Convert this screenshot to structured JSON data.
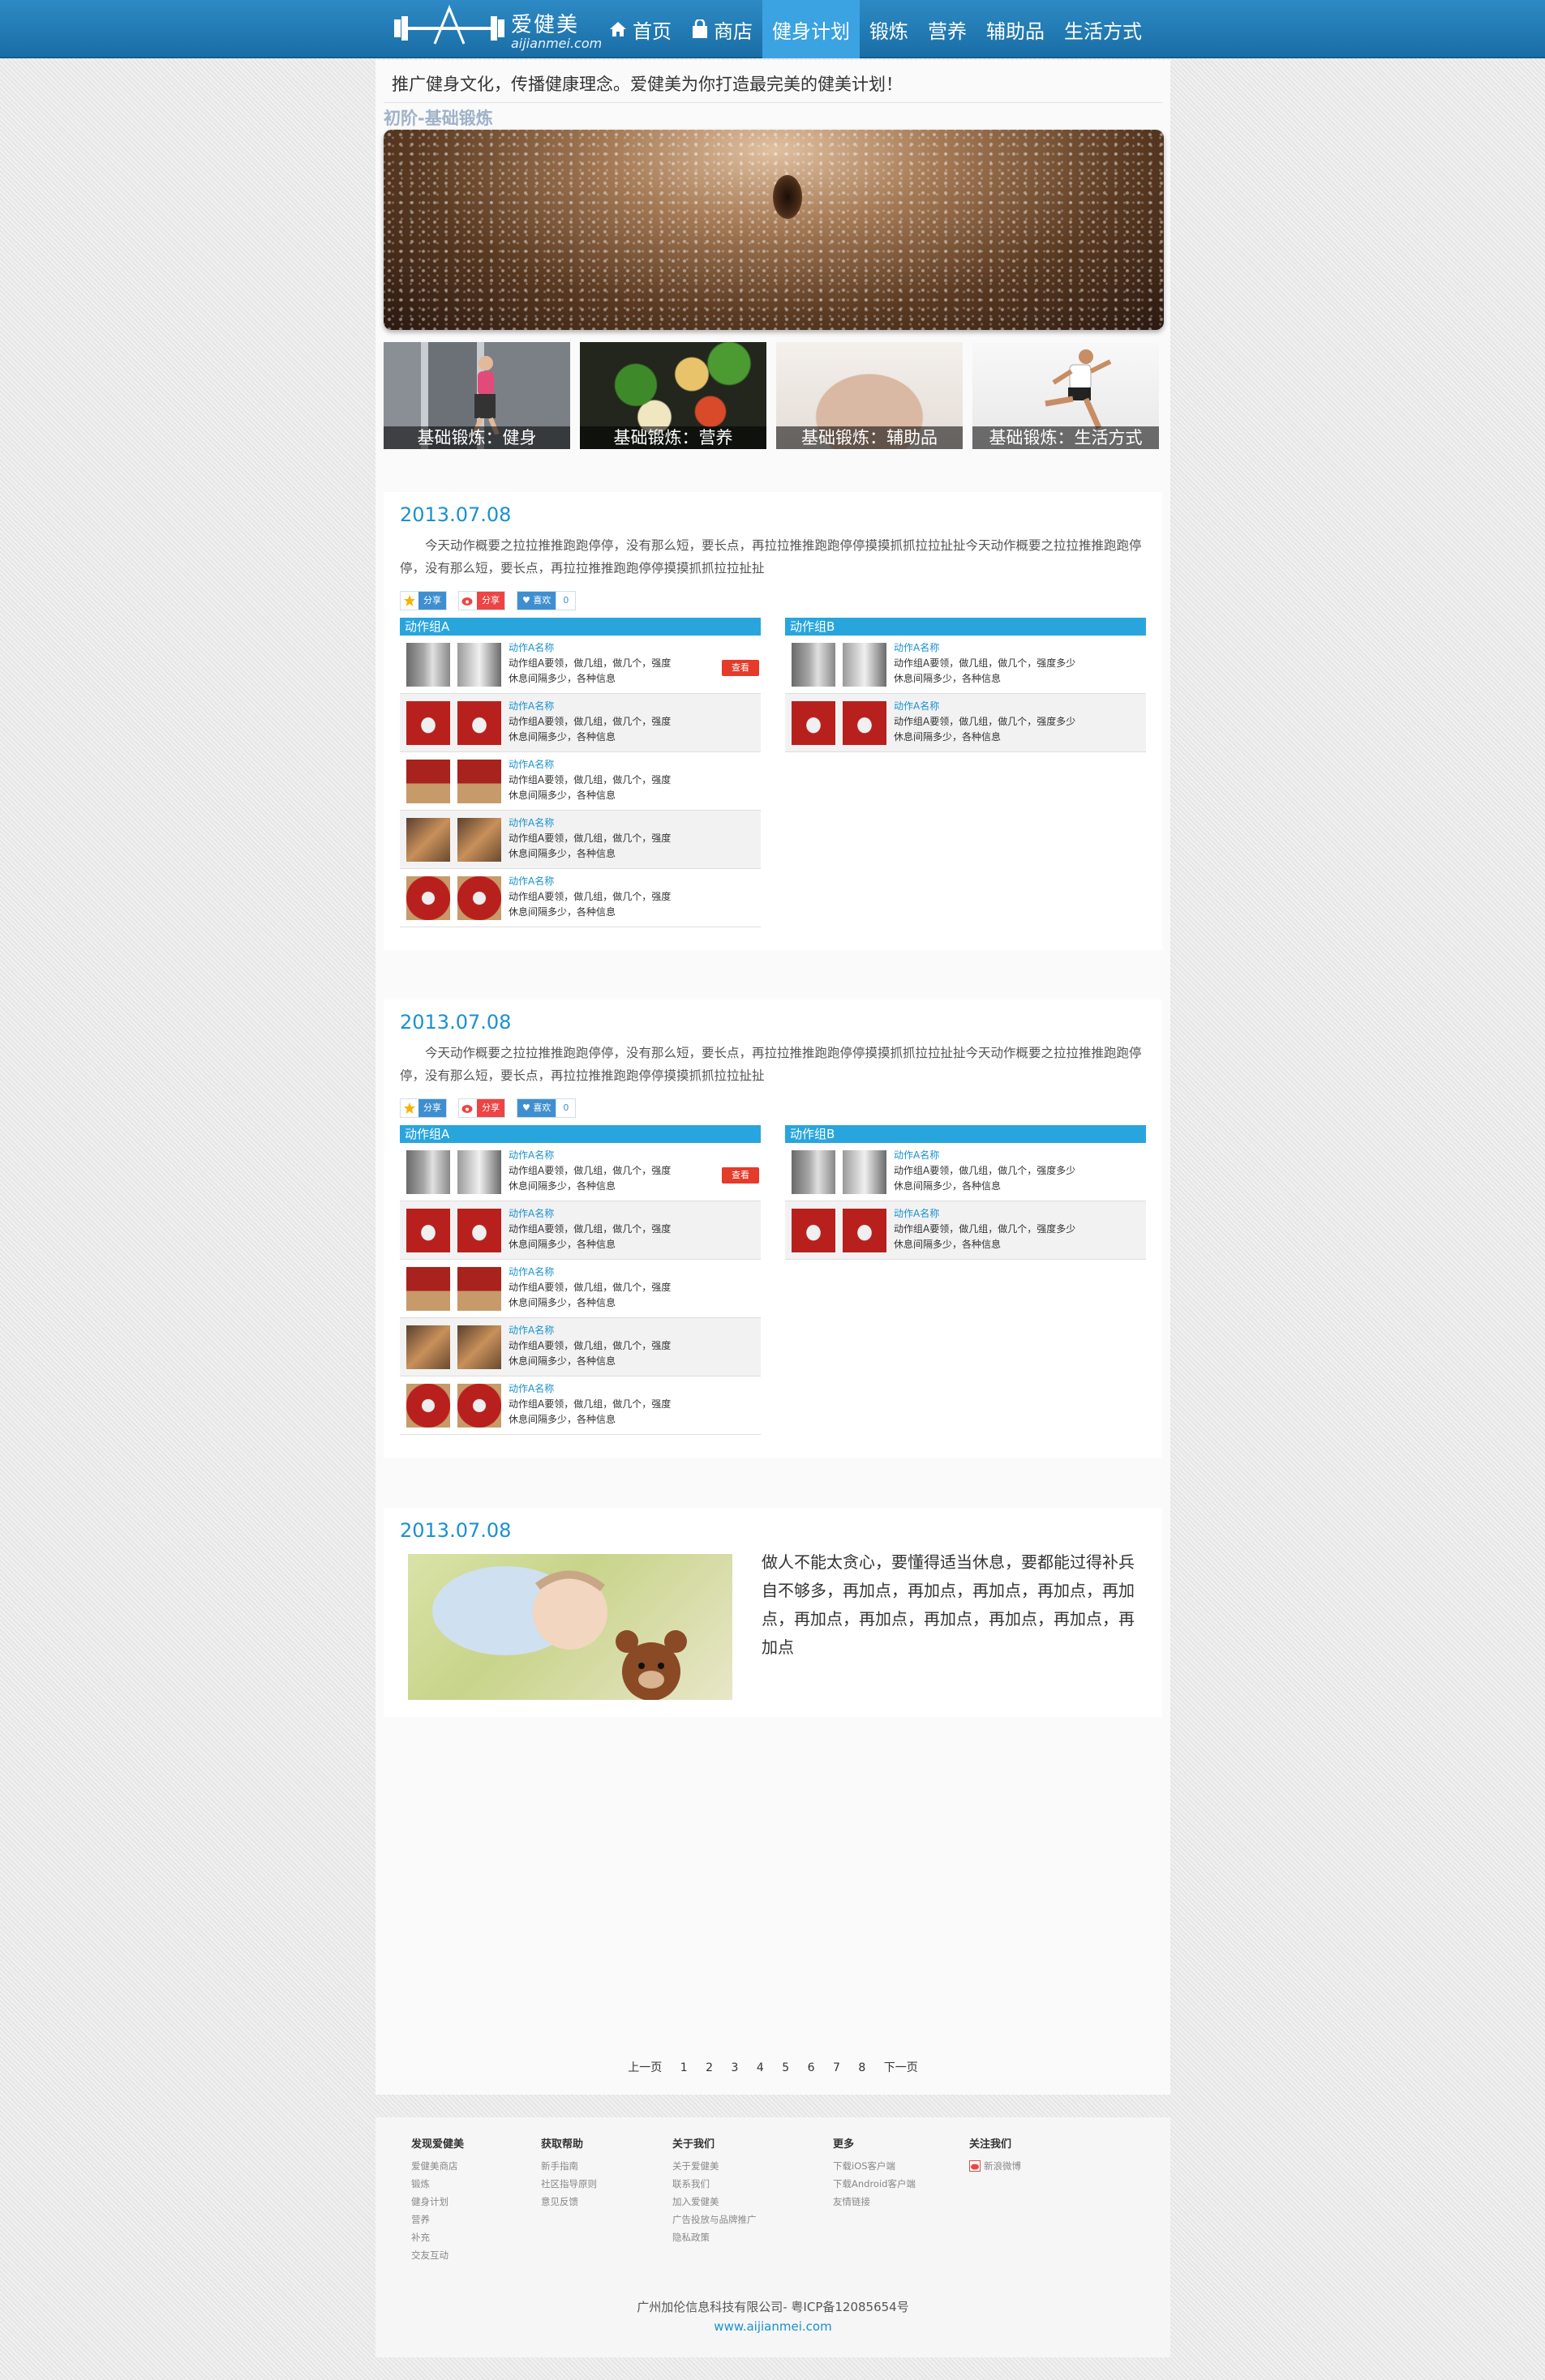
{
  "header": {
    "logo_cn": "爱健美",
    "logo_url": "aijianmei.com",
    "nav": [
      {
        "label": "首页"
      },
      {
        "label": "商店"
      },
      {
        "label": "健身计划"
      },
      {
        "label": "锻炼"
      },
      {
        "label": "营养"
      },
      {
        "label": "辅助品"
      },
      {
        "label": "生活方式"
      }
    ],
    "active_index": 2
  },
  "slogan": "推广健身文化，传播健康理念。爱健美为你打造最完美的健美计划！",
  "breadcrumb": "初阶-基础锻炼",
  "thumbs": [
    {
      "label": "基础锻炼：健身"
    },
    {
      "label": "基础锻炼：营养"
    },
    {
      "label": "基础锻炼：辅助品"
    },
    {
      "label": "基础锻炼：生活方式"
    }
  ],
  "articles": [
    {
      "date": "2013.07.08",
      "text": "今天动作概要之拉拉推推跑跑停停，没有那么短，要长点，再拉拉推推跑跑停停摸摸抓抓拉拉扯扯今天动作概要之拉拉推推跑跑停停，没有那么短，要长点，再拉拉推推跑跑停停摸摸抓抓拉拉扯扯",
      "share": "分享",
      "weibo_share": "分享",
      "like": "喜欢",
      "like_count": "0",
      "group_a": {
        "title": "动作组A",
        "view": "查看",
        "items": [
          {
            "name": "动作A名称",
            "line1": "动作组A要领，做几组，做几个，强度",
            "line2": "休息间隔多少，各种信息"
          },
          {
            "name": "动作A名称",
            "line1": "动作组A要领，做几组，做几个，强度",
            "line2": "休息间隔多少，各种信息"
          },
          {
            "name": "动作A名称",
            "line1": "动作组A要领，做几组，做几个，强度",
            "line2": "休息间隔多少，各种信息"
          },
          {
            "name": "动作A名称",
            "line1": "动作组A要领，做几组，做几个，强度",
            "line2": "休息间隔多少，各种信息"
          },
          {
            "name": "动作A名称",
            "line1": "动作组A要领，做几组，做几个，强度",
            "line2": "休息间隔多少，各种信息"
          }
        ]
      },
      "group_b": {
        "title": "动作组B",
        "items": [
          {
            "name": "动作A名称",
            "line1": "动作组A要领，做几组，做几个，强度多少",
            "line2": "休息间隔多少，各种信息"
          },
          {
            "name": "动作A名称",
            "line1": "动作组A要领，做几组，做几个，强度多少",
            "line2": "休息间隔多少，各种信息"
          }
        ]
      }
    },
    {
      "date": "2013.07.08",
      "text": "今天动作概要之拉拉推推跑跑停停，没有那么短，要长点，再拉拉推推跑跑停停摸摸抓抓拉拉扯扯今天动作概要之拉拉推推跑跑停停，没有那么短，要长点，再拉拉推推跑跑停停摸摸抓抓拉拉扯扯",
      "share": "分享",
      "weibo_share": "分享",
      "like": "喜欢",
      "like_count": "0",
      "group_a": {
        "title": "动作组A",
        "view": "查看",
        "items": [
          {
            "name": "动作A名称",
            "line1": "动作组A要领，做几组，做几个，强度",
            "line2": "休息间隔多少，各种信息"
          },
          {
            "name": "动作A名称",
            "line1": "动作组A要领，做几组，做几个，强度",
            "line2": "休息间隔多少，各种信息"
          },
          {
            "name": "动作A名称",
            "line1": "动作组A要领，做几组，做几个，强度",
            "line2": "休息间隔多少，各种信息"
          },
          {
            "name": "动作A名称",
            "line1": "动作组A要领，做几组，做几个，强度",
            "line2": "休息间隔多少，各种信息"
          },
          {
            "name": "动作A名称",
            "line1": "动作组A要领，做几组，做几个，强度",
            "line2": "休息间隔多少，各种信息"
          }
        ]
      },
      "group_b": {
        "title": "动作组B",
        "items": [
          {
            "name": "动作A名称",
            "line1": "动作组A要领，做几组，做几个，强度多少",
            "line2": "休息间隔多少，各种信息"
          },
          {
            "name": "动作A名称",
            "line1": "动作组A要领，做几组，做几个，强度多少",
            "line2": "休息间隔多少，各种信息"
          }
        ]
      }
    }
  ],
  "story": {
    "date": "2013.07.08",
    "text": "做人不能太贪心，要懂得适当休息，要都能过得补兵自不够多，再加点，再加点，再加点，再加点，再加点，再加点，再加点，再加点，再加点，再加点，再加点"
  },
  "pager": {
    "prev": "上一页",
    "pages": [
      "1",
      "2",
      "3",
      "4",
      "5",
      "6",
      "7",
      "8"
    ],
    "next": "下一页"
  },
  "footer": {
    "cols": [
      {
        "title": "发现爱健美",
        "links": [
          "爱健美商店",
          "锻炼",
          "健身计划",
          "营养",
          "补充",
          "交友互动"
        ]
      },
      {
        "title": "获取帮助",
        "links": [
          "新手指南",
          "社区指导原则",
          "意见反馈"
        ]
      },
      {
        "title": "关于我们",
        "links": [
          "关于爱健美",
          "联系我们",
          "加入爱健美",
          "广告投放与品牌推广",
          "隐私政策"
        ]
      },
      {
        "title": "更多",
        "links": [
          "下载iOS客户端",
          "下载Android客户端",
          "友情链接"
        ]
      },
      {
        "title": "关注我们",
        "links": [
          "新浪微博"
        ]
      }
    ],
    "company": "广州加伦信息科技有限公司- 粤ICP备12085654号",
    "url": "www.aijianmei.com"
  },
  "colors": {
    "nav_bg": "#1f78b4",
    "nav_active": "#3ba3e1",
    "accent": "#1a91d0",
    "group_header": "#29a5de",
    "view_button": "#e43b2a"
  }
}
